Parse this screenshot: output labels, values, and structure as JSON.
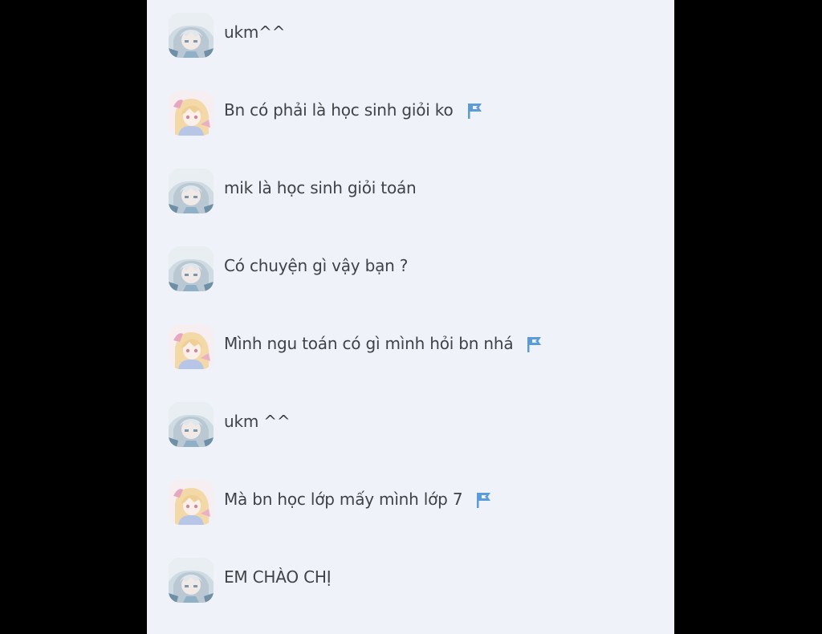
{
  "chat": {
    "messages": [
      {
        "avatar": "silver-hair-avatar",
        "text": "ukm^^",
        "flag": false
      },
      {
        "avatar": "blonde-hair-avatar",
        "text": "Bn có phải là học sinh giỏi ko",
        "flag": true
      },
      {
        "avatar": "silver-hair-avatar",
        "text": "mik là học sinh giỏi toán",
        "flag": false
      },
      {
        "avatar": "silver-hair-avatar",
        "text": "Có chuyện gì vậy bạn ?",
        "flag": false
      },
      {
        "avatar": "blonde-hair-avatar",
        "text": "Mình ngu toán có gì mình hỏi bn nhá",
        "flag": true
      },
      {
        "avatar": "silver-hair-avatar",
        "text": "ukm ^^",
        "flag": false
      },
      {
        "avatar": "blonde-hair-avatar",
        "text": "Mà bn học lớp mấy mình lớp 7",
        "flag": true
      },
      {
        "avatar": "silver-hair-avatar",
        "text": "EM CHÀO CHỊ",
        "flag": false
      }
    ]
  },
  "colors": {
    "background": "#000000",
    "panel": "#eff2f8",
    "text": "#3f4246",
    "flag": "#5a9bd8"
  },
  "icons": {
    "flag": "report-flag-icon"
  }
}
